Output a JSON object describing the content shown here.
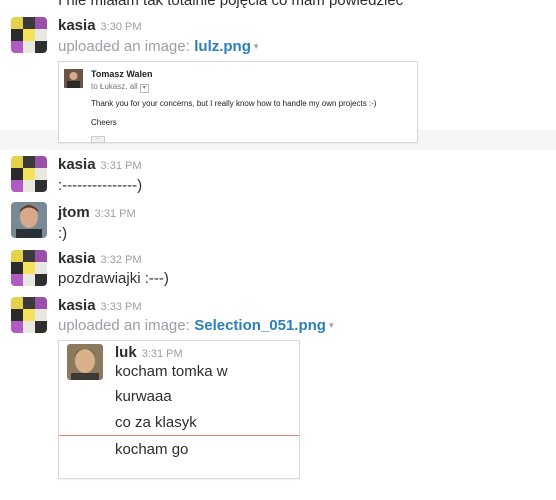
{
  "clipped_line": "I nie miałam tak totalnie pojęcia co mam powiedzieć",
  "messages": [
    {
      "user": "kasia",
      "time": "3:30 PM",
      "uploaded_prefix": "uploaded an image:",
      "file": "lulz.png",
      "caret": "▾"
    },
    {
      "user": "kasia",
      "time": "3:31 PM",
      "text": ":---------------)"
    },
    {
      "user": "jtom",
      "time": "3:31 PM",
      "text": ":)"
    },
    {
      "user": "kasia",
      "time": "3:32 PM",
      "text": "pozdrawiajki :---)"
    },
    {
      "user": "kasia",
      "time": "3:33 PM",
      "uploaded_prefix": "uploaded an image:",
      "file": "Selection_051.png",
      "caret": "▾"
    }
  ],
  "email_preview": {
    "sender": "Tomasz Walen",
    "to": "to Łukasz, all",
    "to_dropdown": "▾",
    "line1": "Thank you for your concerns, but I really know how to handle my own projects :-)",
    "line2": "Cheers",
    "ellipsis": "···"
  },
  "chat_preview": {
    "user": "luk",
    "time": "3:31 PM",
    "lines": [
      "kocham tomka w",
      "kurwaaa",
      "co za klasyk",
      "kocham go"
    ]
  },
  "colors": {
    "link": "#2a80b9",
    "muted": "#9e9ea6",
    "text": "#2c2d30",
    "divider": "#e8856b"
  }
}
